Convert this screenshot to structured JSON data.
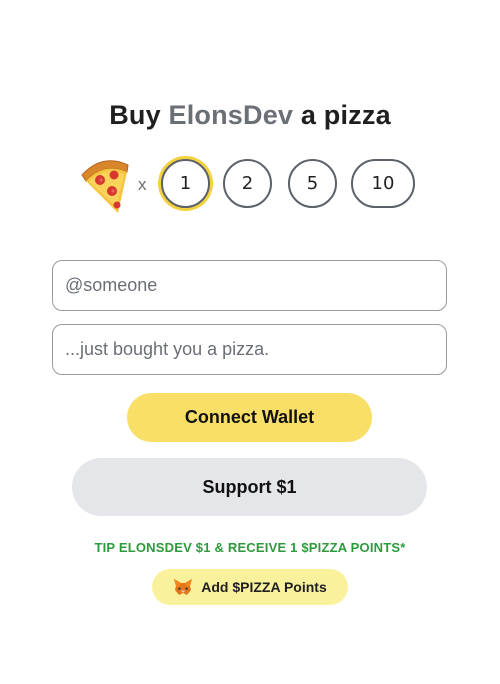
{
  "header": {
    "prefix": "Buy",
    "creator": "ElonsDev",
    "suffix": "a pizza"
  },
  "quantity": {
    "icon": "pizza-slice-icon",
    "multiplier": "x",
    "options": [
      "1",
      "2",
      "5",
      "10"
    ],
    "selected": "1",
    "selected_ring_color": "#f4d23f"
  },
  "form": {
    "name_placeholder": "@someone",
    "message_placeholder": "...just bought you a pizza."
  },
  "actions": {
    "connect_label": "Connect Wallet",
    "connect_color": "#f9df68",
    "support_label": "Support $1",
    "support_color": "#e5e6ea"
  },
  "promo": {
    "tip_text": "TIP ELONSDEV $1 & RECEIVE 1 $PIZZA POINTS*",
    "tip_color": "#2e9a3c",
    "points_icon": "metamask-fox-icon",
    "points_label": "Add $PIZZA Points",
    "points_color": "#faf19c"
  }
}
